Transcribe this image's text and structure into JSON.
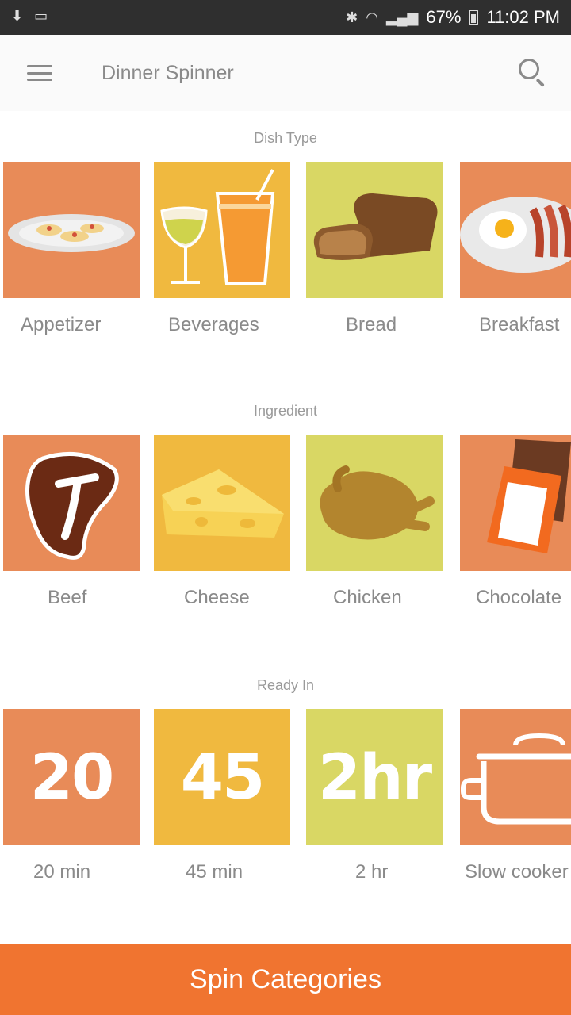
{
  "status_bar": {
    "battery": "67%",
    "time": "11:02 PM"
  },
  "app_bar": {
    "title": "Dinner Spinner",
    "menu_icon": "menu-icon",
    "search_icon": "search-icon"
  },
  "sections": [
    {
      "title": "Dish Type",
      "items": [
        {
          "label": "Appetizer",
          "icon": "appetizer-plate-icon",
          "color": "#e88b58"
        },
        {
          "label": "Beverages",
          "icon": "beverages-glasses-icon",
          "color": "#f0b93f"
        },
        {
          "label": "Bread",
          "icon": "bread-loaf-icon",
          "color": "#d9d764"
        },
        {
          "label": "Breakfast",
          "icon": "breakfast-plate-icon",
          "color": "#e88b58"
        }
      ]
    },
    {
      "title": "Ingredient",
      "items": [
        {
          "label": "Beef",
          "icon": "steak-icon",
          "color": "#e88b58"
        },
        {
          "label": "Cheese",
          "icon": "cheese-icon",
          "color": "#f0b93f"
        },
        {
          "label": "Chicken",
          "icon": "roast-chicken-icon",
          "color": "#d9d764"
        },
        {
          "label": "Chocolate",
          "icon": "chocolate-bar-icon",
          "color": "#e88b58"
        }
      ]
    },
    {
      "title": "Ready In",
      "items": [
        {
          "label": "20 min",
          "tile_text": "20",
          "icon": "20-min-icon",
          "color": "#e88b58"
        },
        {
          "label": "45 min",
          "tile_text": "45",
          "icon": "45-min-icon",
          "color": "#f0b93f"
        },
        {
          "label": "2 hr",
          "tile_text": "2hr",
          "icon": "2-hr-icon",
          "color": "#d9d764"
        },
        {
          "label": "Slow cooker",
          "icon": "slow-cooker-pot-icon",
          "color": "#e88b58"
        }
      ]
    }
  ],
  "spin_button": "Spin Categories"
}
